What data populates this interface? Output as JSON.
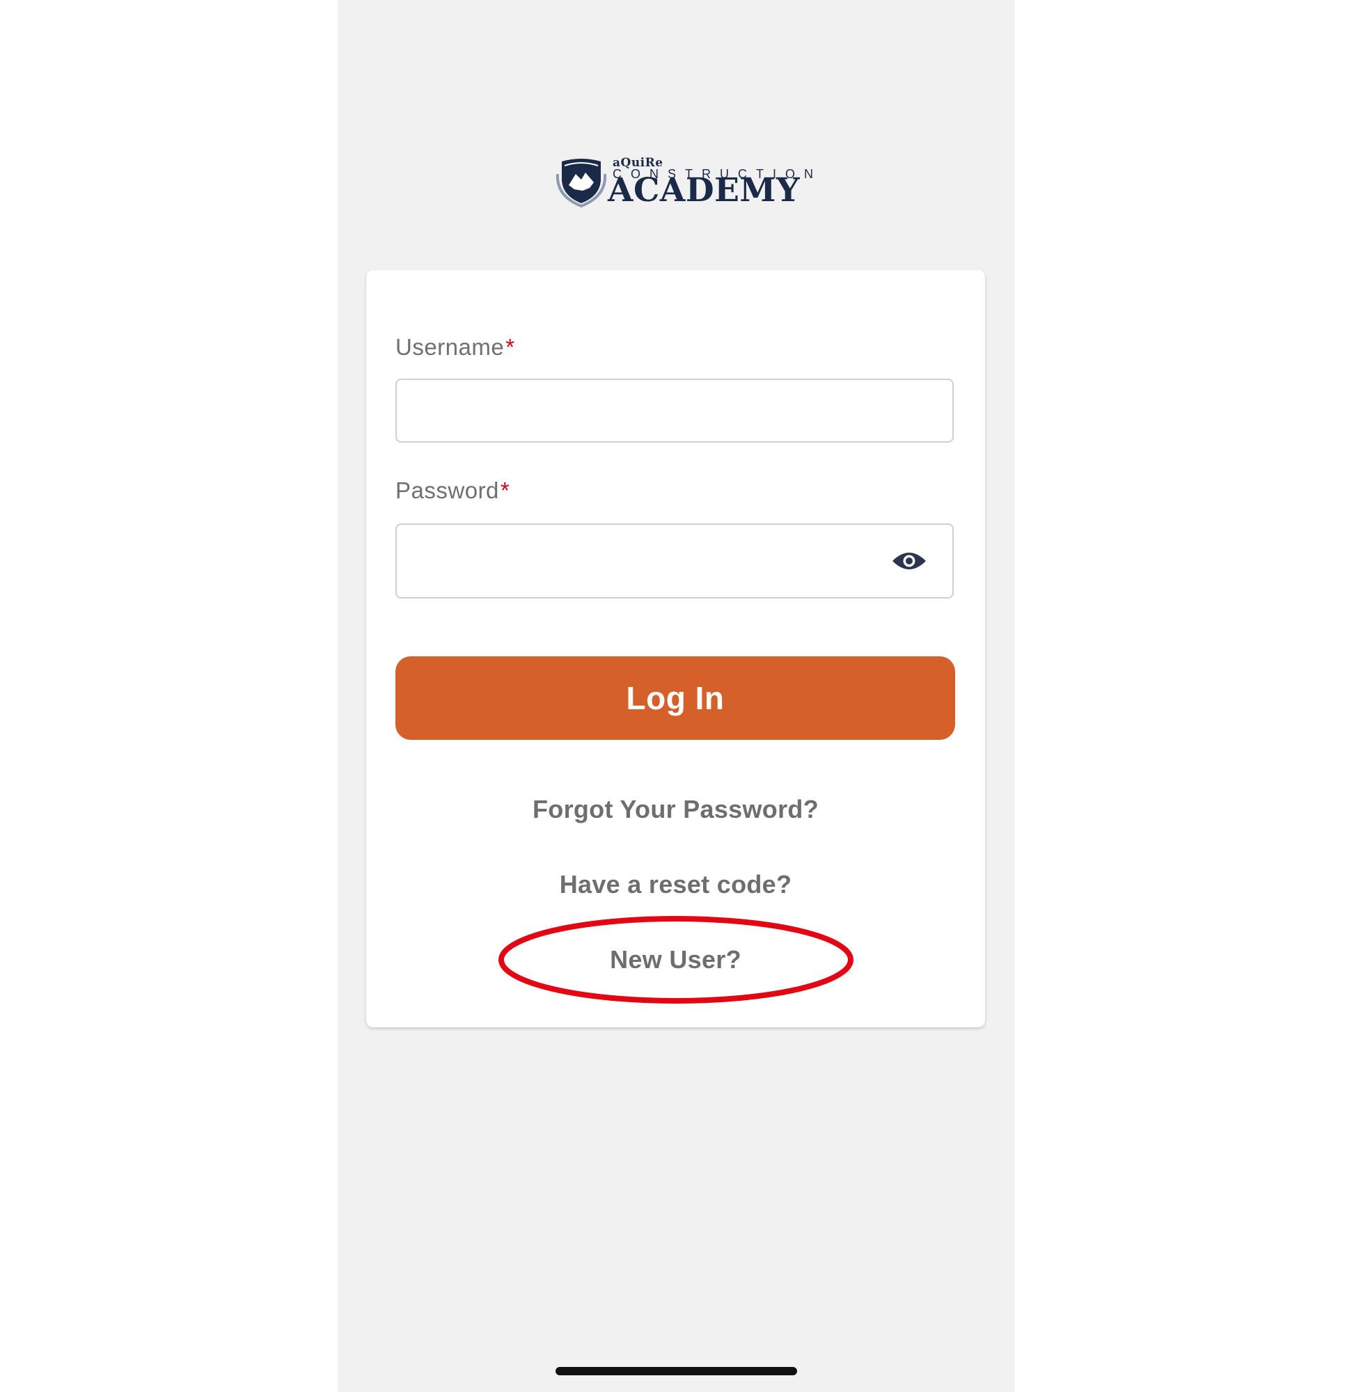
{
  "logo": {
    "line1": "aQuiRe",
    "line2": "CONSTRUCTION",
    "line3": "ACADEMY"
  },
  "form": {
    "username_label": "Username",
    "password_label": "Password",
    "required_mark": "*",
    "username_value": "",
    "password_value": "",
    "login_label": "Log In"
  },
  "links": {
    "forgot_password": "Forgot Your Password?",
    "reset_code": "Have a reset code?",
    "new_user": "New User?"
  },
  "colors": {
    "accent": "#d6602a",
    "brand_navy": "#1b2a48",
    "highlight_red": "#e30613",
    "required_red": "#d0021b"
  },
  "icons": {
    "password_toggle": "eye-icon",
    "logo_emblem": "shield-crest-icon"
  }
}
